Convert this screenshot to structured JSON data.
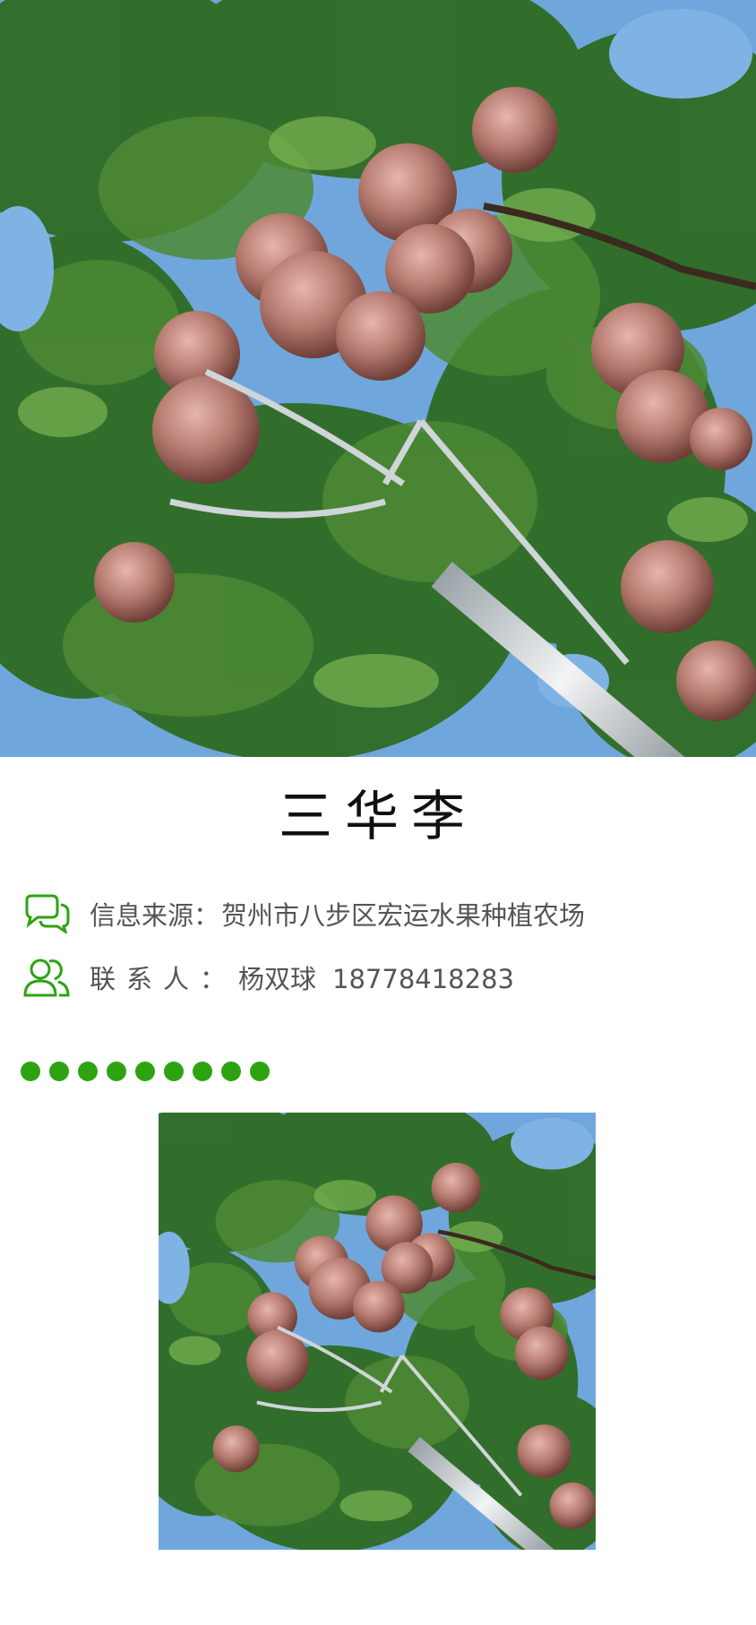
{
  "product": {
    "title": "三华李"
  },
  "info": {
    "source_label": "信息来源：",
    "source_value": "贺州市八步区宏运水果种植农场",
    "contact_label": "联系人：",
    "contact_name": "杨双球",
    "contact_phone": "18778418283",
    "source_icon": "chat-bubbles-icon",
    "contact_icon": "people-icon"
  },
  "decor": {
    "dot_count": 9,
    "dot_color": "#2ea312"
  },
  "images": {
    "hero": "plums-on-tree-with-picker-pole",
    "thumb": "plums-on-tree-with-picker-pole"
  },
  "colors": {
    "accent": "#2ea312",
    "text": "#555555",
    "title": "#111111"
  }
}
